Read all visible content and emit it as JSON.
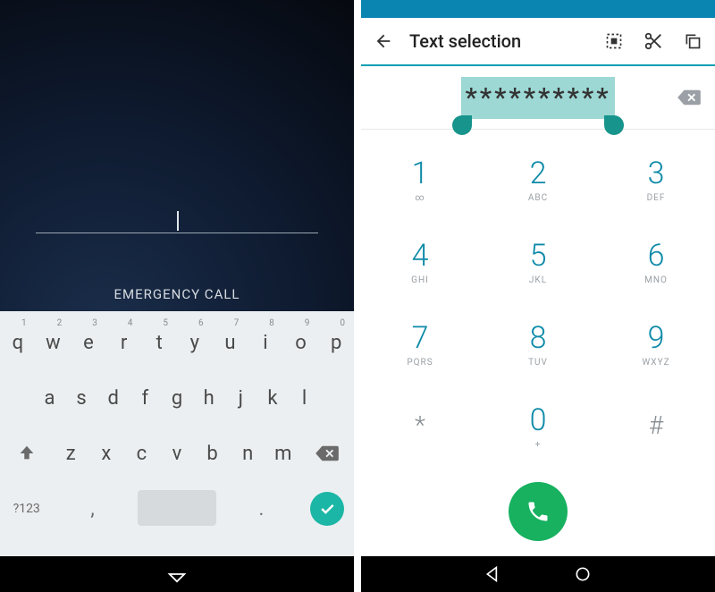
{
  "left": {
    "password_value": "",
    "emergency_label": "EMERGENCY CALL",
    "keyboard": {
      "row1": [
        {
          "key": "q",
          "sup": "1"
        },
        {
          "key": "w",
          "sup": "2"
        },
        {
          "key": "e",
          "sup": "3"
        },
        {
          "key": "r",
          "sup": "4"
        },
        {
          "key": "t",
          "sup": "5"
        },
        {
          "key": "y",
          "sup": "6"
        },
        {
          "key": "u",
          "sup": "7"
        },
        {
          "key": "i",
          "sup": "8"
        },
        {
          "key": "o",
          "sup": "9"
        },
        {
          "key": "p",
          "sup": "0"
        }
      ],
      "row2": [
        "a",
        "s",
        "d",
        "f",
        "g",
        "h",
        "j",
        "k",
        "l"
      ],
      "row3": [
        "z",
        "x",
        "c",
        "v",
        "b",
        "n",
        "m"
      ],
      "sym_label": "?123",
      "comma": ",",
      "dot": "."
    }
  },
  "right": {
    "toolbar_title": "Text selection",
    "input_value": "**********",
    "keys": [
      {
        "num": "1",
        "ltr": "∞"
      },
      {
        "num": "2",
        "ltr": "ABC"
      },
      {
        "num": "3",
        "ltr": "DEF"
      },
      {
        "num": "4",
        "ltr": "GHI"
      },
      {
        "num": "5",
        "ltr": "JKL"
      },
      {
        "num": "6",
        "ltr": "MNO"
      },
      {
        "num": "7",
        "ltr": "PQRS"
      },
      {
        "num": "8",
        "ltr": "TUV"
      },
      {
        "num": "9",
        "ltr": "WXYZ"
      },
      {
        "num": "*",
        "ltr": "",
        "sym": true
      },
      {
        "num": "0",
        "ltr": "+"
      },
      {
        "num": "#",
        "ltr": "",
        "sym": true
      }
    ]
  }
}
